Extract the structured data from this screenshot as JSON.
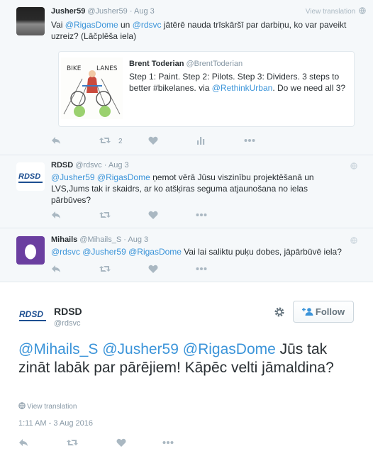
{
  "tweets": [
    {
      "name": "Jusher59",
      "handle": "@Jusher59",
      "sep": "·",
      "time": "Aug 3",
      "view_translation": "View translation",
      "text": {
        "m1": "@RigasDome",
        "t1": " un ",
        "m2": "@rdsvc",
        "t2": " jātērē nauda trīskāršī par darbiņu, ko var paveikt uzreiz? (Lāčplēša iela)"
      },
      "retweets": "2",
      "card": {
        "name": "Brent Toderian",
        "handle": "@BrentToderian",
        "text": {
          "t1": "Step 1: Paint. Step 2: Pilots. Step 3: Dividers. 3 steps to better #bikelanes. via ",
          "m1": "@RethinkUrban",
          "t2": ". Do we need all 3?"
        },
        "image_text": {
          "left": "BIKE",
          "right": "LANES"
        }
      }
    },
    {
      "name": "RDSD",
      "handle": "@rdsvc",
      "sep": "·",
      "time": "Aug 3",
      "text": {
        "m1": "@Jusher59",
        "t0": " ",
        "m2": "@RigasDome",
        "t1": " ņemot vērā Jūsu viszinību projektēšanā un LVS,Jums tak ir skaidrs, ar ko atšķiras seguma atjaunošana no ielas pārbūves?"
      }
    },
    {
      "name": "Mihails",
      "handle": "@Mihails_S",
      "sep": "·",
      "time": "Aug 3",
      "text": {
        "m1": "@rdsvc",
        "m2": "@Jusher59",
        "m3": "@RigasDome",
        "t1": " Vai lai saliktu puķu dobes, jāpārbūvē iela?"
      }
    }
  ],
  "main": {
    "name": "RDSD",
    "handle": "@rdsvc",
    "follow_label": "Follow",
    "text": {
      "m1": "@Mihails_S",
      "m2": "@Jusher59",
      "m3": "@RigasDome",
      "t1": " Jūs tak zināt labāk par pārējiem! Kāpēc velti jāmaldina?"
    },
    "view_translation": "View translation",
    "timestamp": "1:11 AM - 3 Aug 2016"
  },
  "logo_text": "RDSD",
  "colors": {
    "link": "#3b94d9",
    "muted": "#8899a6",
    "icon": "#aab8c2",
    "avatar_purple": "#6b3fa0",
    "logo_blue": "#1d4f91"
  }
}
